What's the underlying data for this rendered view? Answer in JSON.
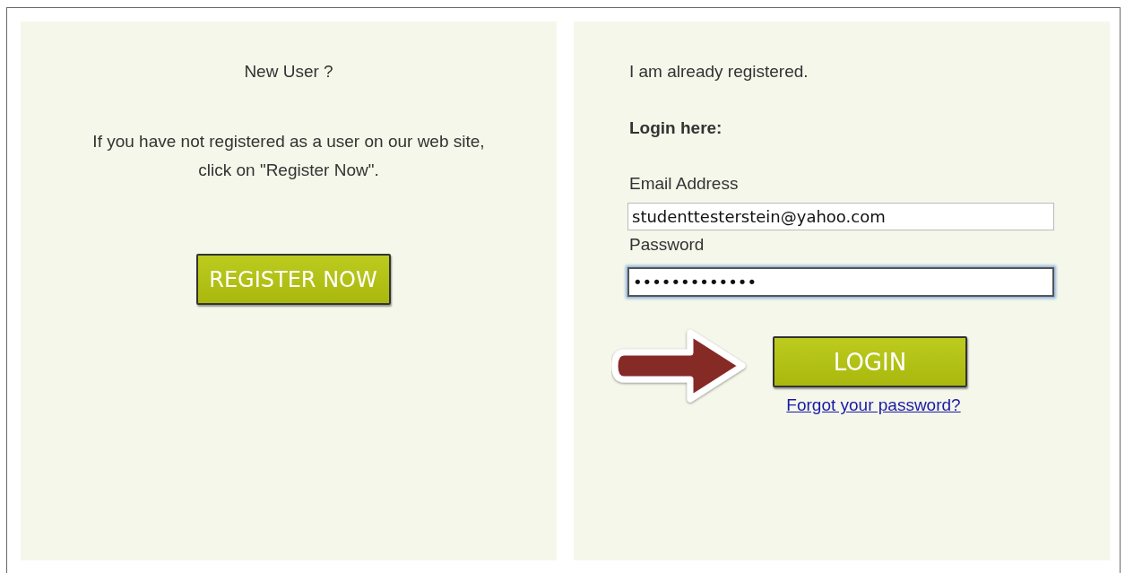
{
  "new_user": {
    "heading": "New User ?",
    "text": "If you have not registered as a user on our web site, click on \"Register Now\".",
    "button": "REGISTER NOW"
  },
  "login": {
    "intro": "I am already registered.",
    "heading": "Login here:",
    "fields": [
      {
        "label": "Email Address",
        "value": "studenttesterstein@yahoo.com",
        "focused": false
      },
      {
        "label": "Password",
        "value": "•••••••••••••",
        "focused": true
      }
    ],
    "button": "LOGIN",
    "link": "Forgot your password?"
  }
}
